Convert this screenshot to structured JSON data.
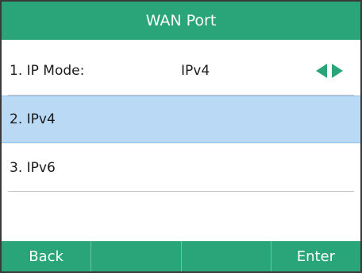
{
  "title": "WAN Port",
  "menu": [
    {
      "label": "1. IP Mode:",
      "value": "IPv4"
    },
    {
      "label": "2. IPv4"
    },
    {
      "label": "3. IPv6"
    }
  ],
  "softkeys": [
    "Back",
    "",
    "",
    "Enter"
  ],
  "icons": {
    "left": "arrow-left-icon",
    "right": "arrow-right-icon"
  },
  "colors": {
    "accent": "#2aa57a",
    "selected": "#b9d9f5"
  }
}
